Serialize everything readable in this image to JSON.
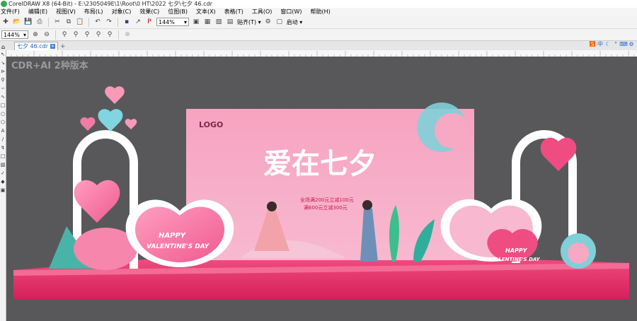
{
  "window": {
    "title": "CorelDRAW X8 (64-Bit) - E:\\2305049E\\1\\Root\\0 HT\\2022 七夕\\七夕 46.cdr"
  },
  "menu": [
    "文件(F)",
    "编辑(E)",
    "视图(V)",
    "布局(L)",
    "对象(C)",
    "效果(C)",
    "位图(B)",
    "文本(X)",
    "表格(T)",
    "工具(O)",
    "窗口(W)",
    "帮助(H)"
  ],
  "toolbar": {
    "zoom_value": "144%",
    "snap_label": "贴齐(T)",
    "launch_label": "启动"
  },
  "toolbar2": {
    "zoom_value": "144%"
  },
  "tab": {
    "label": "七夕 46.cdr"
  },
  "sys": {
    "ime": "中"
  },
  "canvas_text": {
    "watermark": "CDR+AI 2种版本",
    "logo": "LOGO",
    "headline": "爱在七夕",
    "sub_line1": "全场满200元立减100元",
    "sub_line2": "满600元立减300元",
    "valentine_left_1": "HAPPY",
    "valentine_left_2": "VALENTINE'S DAY",
    "valentine_right_1": "HAPPY",
    "valentine_right_2": "VALENTINE'S DAY"
  },
  "colors": {
    "canvas_bg": "#58585a",
    "pink": "#f06b9b",
    "stage": "#e8336d"
  },
  "icons": [
    "new-icon",
    "open-icon",
    "save-icon",
    "print-icon",
    "cut-icon",
    "copy-icon",
    "paste-icon",
    "undo-icon",
    "redo-icon",
    "import-icon",
    "export-icon",
    "full-screen-icon",
    "grid-icon",
    "guides-icon",
    "gear-icon",
    "zoom-in-icon",
    "zoom-out-icon"
  ]
}
